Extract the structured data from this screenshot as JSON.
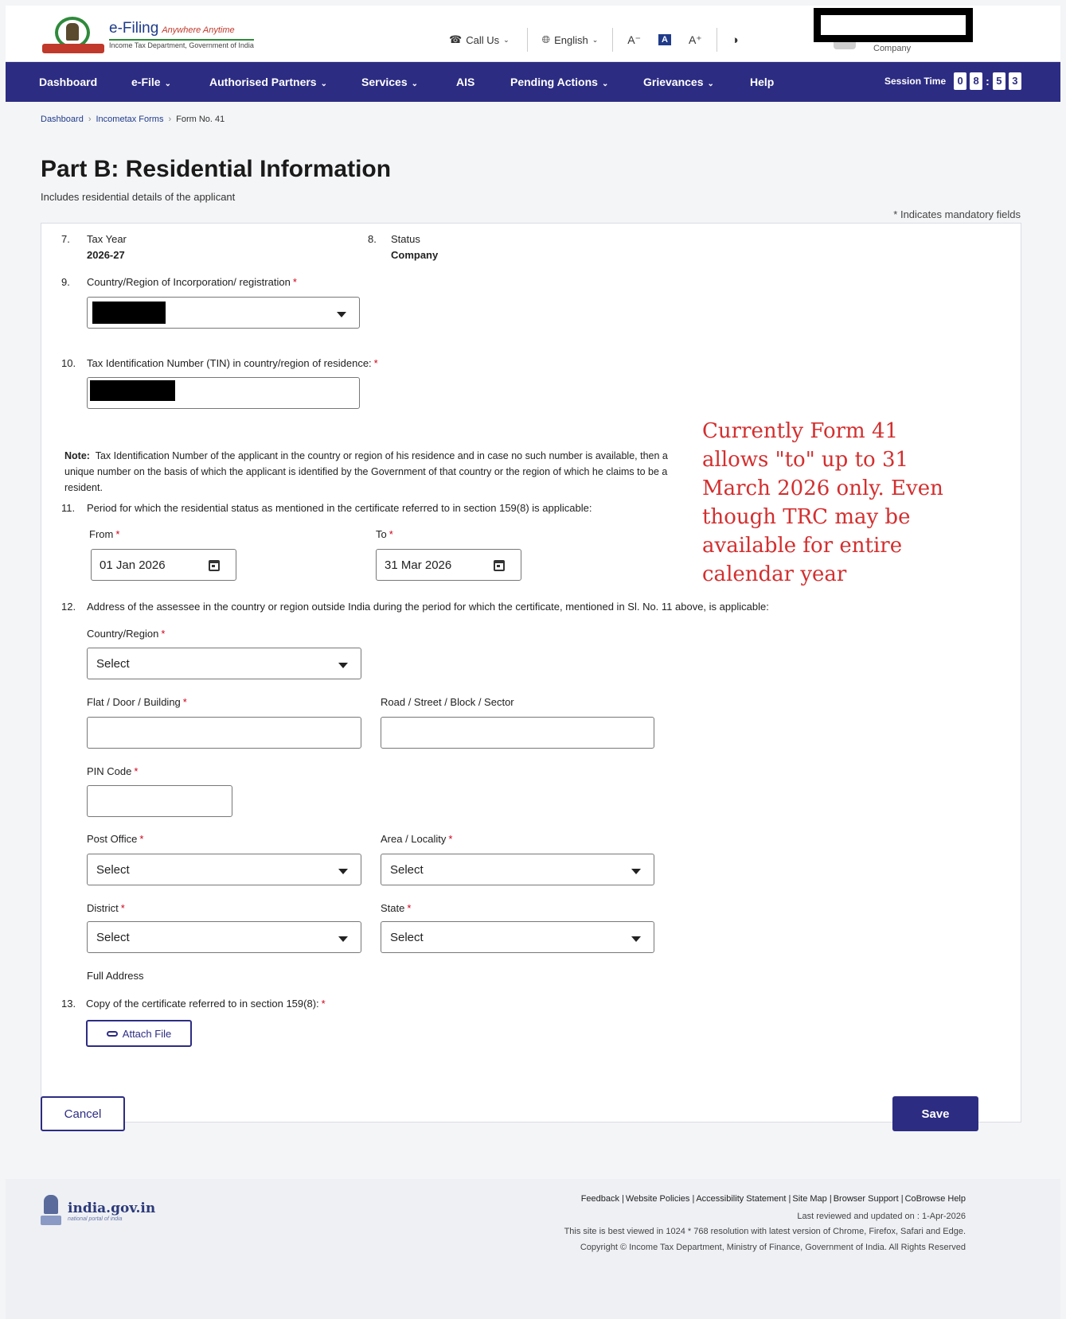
{
  "header": {
    "logo_title": "e-Filing",
    "logo_tagline": "Anywhere Anytime",
    "logo_subtitle": "Income Tax Department, Government of India",
    "call_us": "Call Us",
    "language": "English",
    "font_decrease": "A⁻",
    "font_default": "A",
    "font_increase": "A⁺",
    "user_role": "Company"
  },
  "nav": {
    "items": [
      {
        "label": "Dashboard"
      },
      {
        "label": "e-File"
      },
      {
        "label": "Authorised Partners"
      },
      {
        "label": "Services"
      },
      {
        "label": "AIS"
      },
      {
        "label": "Pending Actions"
      },
      {
        "label": "Grievances"
      },
      {
        "label": "Help"
      }
    ],
    "session_label": "Session Time",
    "session_digits": [
      "0",
      "8",
      "5",
      "3"
    ]
  },
  "breadcrumb": [
    "Dashboard",
    "Incometax Forms",
    "Form No. 41"
  ],
  "page": {
    "title": "Part B: Residential Information",
    "subtitle": "Includes residential details of the applicant",
    "mandatory_note": "* Indicates mandatory fields"
  },
  "form": {
    "tax_year": {
      "num": "7.",
      "label": "Tax Year",
      "value": "2026-27"
    },
    "status": {
      "num": "8.",
      "label": "Status",
      "value": "Company"
    },
    "country_incorp": {
      "num": "9.",
      "label": "Country/Region of Incorporation/ registration"
    },
    "tin": {
      "num": "10.",
      "label": "Tax Identification Number (TIN) in country/region of residence:"
    },
    "note_label": "Note:",
    "note_text": "Tax Identification Number of the applicant in the country or region of his residence and in case no such number is available, then a unique number on the basis of which the applicant is identified by the Government of that country or the region of which he claims to be a resident.",
    "period": {
      "num": "11.",
      "label": "Period for which the residential status as mentioned in the certificate referred to in section 159(8) is applicable:",
      "from_label": "From",
      "from_value": "01 Jan 2026",
      "to_label": "To",
      "to_value": "31 Mar 2026"
    },
    "address": {
      "num": "12.",
      "label": "Address of the assessee in the country or region outside India during the period for which the certificate, mentioned in Sl. No. 11 above, is applicable:",
      "country_label": "Country/Region",
      "country_value": "Select",
      "flat_label": "Flat / Door / Building",
      "road_label": "Road / Street / Block / Sector",
      "pin_label": "PIN Code",
      "post_office_label": "Post Office",
      "post_office_value": "Select",
      "area_label": "Area / Locality",
      "area_value": "Select",
      "district_label": "District",
      "district_value": "Select",
      "state_label": "State",
      "state_value": "Select",
      "full_address_label": "Full Address"
    },
    "certificate": {
      "num": "13.",
      "label": "Copy of the certificate referred to in section 159(8):",
      "attach_label": "Attach File"
    },
    "required_mark": "*"
  },
  "annotation": "Currently Form 41 allows \"to\" up to 31 March 2026 only. Even though TRC may be available for entire calendar year",
  "buttons": {
    "cancel": "Cancel",
    "save": "Save"
  },
  "footer": {
    "portal_name": "india.gov.in",
    "portal_sub": "national portal of india",
    "links": [
      "Feedback",
      "Website Policies",
      "Accessibility Statement",
      "Site Map",
      "Browser Support",
      "CoBrowse Help"
    ],
    "last_reviewed": "Last reviewed and updated on : 1-Apr-2026",
    "best_viewed": "This site is best viewed in 1024 * 768 resolution with latest version of Chrome, Firefox, Safari and Edge.",
    "copyright": "Copyright © Income Tax Department, Ministry of Finance, Government of India. All Rights Reserved"
  },
  "colors": {
    "nav_bg": "#2d2c83",
    "annotation": "#d32f2f",
    "required": "#d0021b"
  }
}
